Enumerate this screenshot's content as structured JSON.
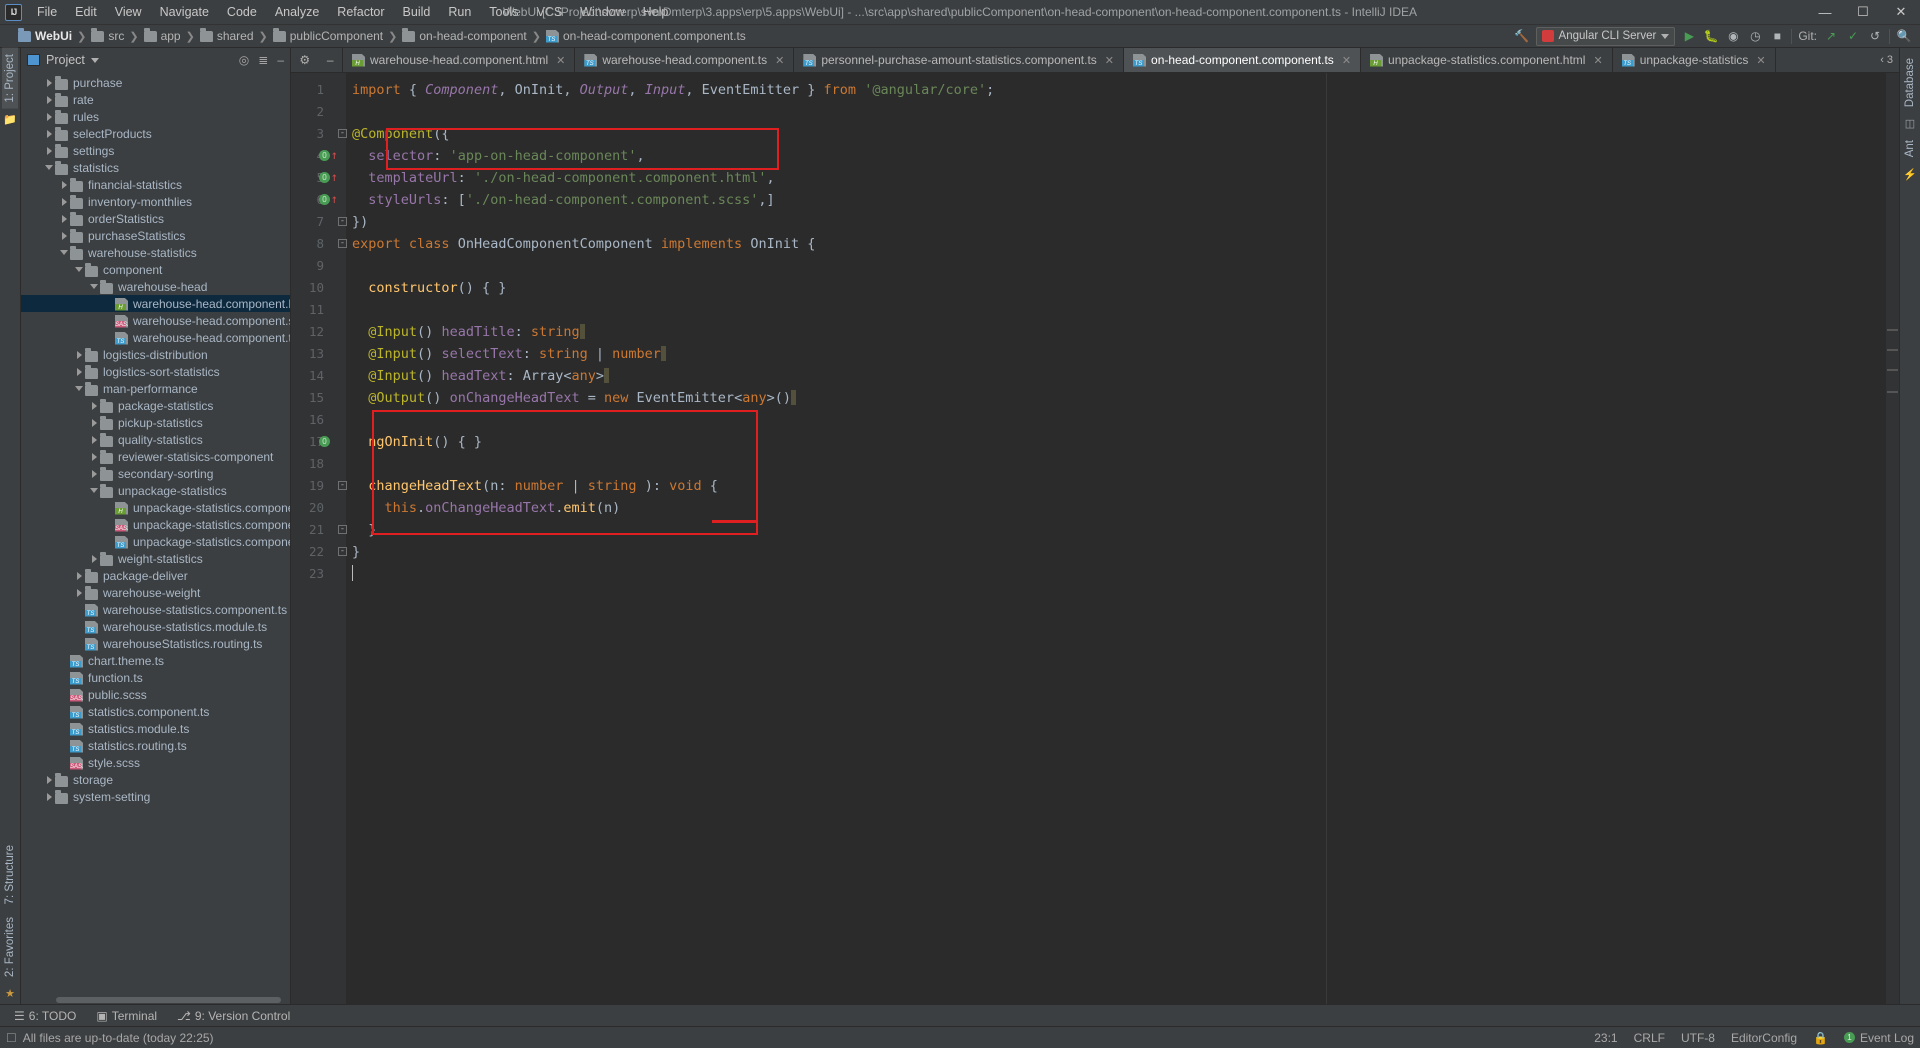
{
  "window": {
    "title": "WebUi [C:\\Project\\svnerp\\svn\\Dmterp\\3.apps\\erp\\5.apps\\WebUi] - ...\\src\\app\\shared\\publicComponent\\on-head-component\\on-head-component.component.ts - IntelliJ IDEA",
    "logo": "IJ",
    "minimize": "—",
    "maximize": "☐",
    "close": "✕"
  },
  "menubar": [
    "File",
    "Edit",
    "View",
    "Navigate",
    "Code",
    "Analyze",
    "Refactor",
    "Build",
    "Run",
    "Tools",
    "VCS",
    "Window",
    "Help"
  ],
  "breadcrumb": [
    {
      "label": "WebUi",
      "icon": "folder-icon"
    },
    {
      "label": "src",
      "icon": "folder-icon"
    },
    {
      "label": "app",
      "icon": "folder-icon"
    },
    {
      "label": "shared",
      "icon": "folder-icon"
    },
    {
      "label": "publicComponent",
      "icon": "folder-icon"
    },
    {
      "label": "on-head-component",
      "icon": "folder-icon"
    },
    {
      "label": "on-head-component.component.ts",
      "icon": "typescript-file-icon"
    }
  ],
  "toolbar": {
    "build_icon": "hammer-icon",
    "run_config": "Angular CLI Server",
    "run_icon": "run-icon",
    "debug_icon": "debug-icon",
    "stop_icon": "stop-icon",
    "coverage_icon": "coverage-icon",
    "profile_icon": "profiler-icon",
    "git_label": "Git:",
    "git_update_icon": "update-project-icon",
    "git_commit_icon": "commit-icon",
    "git_history_icon": "history-icon",
    "search_icon": "search-icon"
  },
  "project_panel": {
    "title": "Project",
    "locate_icon": "locate-file-icon",
    "collapse_icon": "collapse-all-icon",
    "hide_icon": "hide-icon",
    "tree": [
      {
        "label": "purchase",
        "type": "folder",
        "indent": 1,
        "state": "collapsed"
      },
      {
        "label": "rate",
        "type": "folder",
        "indent": 1,
        "state": "collapsed"
      },
      {
        "label": "rules",
        "type": "folder",
        "indent": 1,
        "state": "collapsed"
      },
      {
        "label": "selectProducts",
        "type": "folder",
        "indent": 1,
        "state": "collapsed"
      },
      {
        "label": "settings",
        "type": "folder",
        "indent": 1,
        "state": "collapsed"
      },
      {
        "label": "statistics",
        "type": "folder",
        "indent": 1,
        "state": "expanded"
      },
      {
        "label": "financial-statistics",
        "type": "folder",
        "indent": 2,
        "state": "collapsed"
      },
      {
        "label": "inventory-monthlies",
        "type": "folder",
        "indent": 2,
        "state": "collapsed"
      },
      {
        "label": "orderStatistics",
        "type": "folder",
        "indent": 2,
        "state": "collapsed"
      },
      {
        "label": "purchaseStatistics",
        "type": "folder",
        "indent": 2,
        "state": "collapsed"
      },
      {
        "label": "warehouse-statistics",
        "type": "folder",
        "indent": 2,
        "state": "expanded"
      },
      {
        "label": "component",
        "type": "folder",
        "indent": 3,
        "state": "expanded"
      },
      {
        "label": "warehouse-head",
        "type": "folder",
        "indent": 4,
        "state": "expanded"
      },
      {
        "label": "warehouse-head.component.html",
        "type": "html",
        "indent": 5,
        "state": "none",
        "selected": true
      },
      {
        "label": "warehouse-head.component.scss",
        "type": "scss",
        "indent": 5,
        "state": "none"
      },
      {
        "label": "warehouse-head.component.ts",
        "type": "ts",
        "indent": 5,
        "state": "none"
      },
      {
        "label": "logistics-distribution",
        "type": "folder",
        "indent": 3,
        "state": "collapsed"
      },
      {
        "label": "logistics-sort-statistics",
        "type": "folder",
        "indent": 3,
        "state": "collapsed"
      },
      {
        "label": "man-performance",
        "type": "folder",
        "indent": 3,
        "state": "expanded"
      },
      {
        "label": "package-statistics",
        "type": "folder",
        "indent": 4,
        "state": "collapsed"
      },
      {
        "label": "pickup-statistics",
        "type": "folder",
        "indent": 4,
        "state": "collapsed"
      },
      {
        "label": "quality-statistics",
        "type": "folder",
        "indent": 4,
        "state": "collapsed"
      },
      {
        "label": "reviewer-statisics-component",
        "type": "folder",
        "indent": 4,
        "state": "collapsed"
      },
      {
        "label": "secondary-sorting",
        "type": "folder",
        "indent": 4,
        "state": "collapsed"
      },
      {
        "label": "unpackage-statistics",
        "type": "folder",
        "indent": 4,
        "state": "expanded"
      },
      {
        "label": "unpackage-statistics.component.html",
        "type": "html",
        "indent": 5,
        "state": "none"
      },
      {
        "label": "unpackage-statistics.component.scss",
        "type": "scss",
        "indent": 5,
        "state": "none"
      },
      {
        "label": "unpackage-statistics.component.ts",
        "type": "ts",
        "indent": 5,
        "state": "none"
      },
      {
        "label": "weight-statistics",
        "type": "folder",
        "indent": 4,
        "state": "collapsed"
      },
      {
        "label": "package-deliver",
        "type": "folder",
        "indent": 3,
        "state": "collapsed"
      },
      {
        "label": "warehouse-weight",
        "type": "folder",
        "indent": 3,
        "state": "collapsed"
      },
      {
        "label": "warehouse-statistics.component.ts",
        "type": "ts",
        "indent": 3,
        "state": "none"
      },
      {
        "label": "warehouse-statistics.module.ts",
        "type": "ts",
        "indent": 3,
        "state": "none"
      },
      {
        "label": "warehouseStatistics.routing.ts",
        "type": "ts",
        "indent": 3,
        "state": "none"
      },
      {
        "label": "chart.theme.ts",
        "type": "ts",
        "indent": 2,
        "state": "none"
      },
      {
        "label": "function.ts",
        "type": "ts",
        "indent": 2,
        "state": "none"
      },
      {
        "label": "public.scss",
        "type": "scss",
        "indent": 2,
        "state": "none"
      },
      {
        "label": "statistics.component.ts",
        "type": "ts",
        "indent": 2,
        "state": "none"
      },
      {
        "label": "statistics.module.ts",
        "type": "ts",
        "indent": 2,
        "state": "none"
      },
      {
        "label": "statistics.routing.ts",
        "type": "ts",
        "indent": 2,
        "state": "none"
      },
      {
        "label": "style.scss",
        "type": "scss",
        "indent": 2,
        "state": "none"
      },
      {
        "label": "storage",
        "type": "folder",
        "indent": 1,
        "state": "collapsed"
      },
      {
        "label": "system-setting",
        "type": "folder",
        "indent": 1,
        "state": "collapsed"
      }
    ]
  },
  "left_strip": {
    "project_tab": "1: Project",
    "structure_tab": "7: Structure",
    "favorites_tab": "2: Favorites"
  },
  "right_strip": {
    "database_tab": "Database",
    "ant_tab": "Ant"
  },
  "editor_tabs": [
    {
      "label": "warehouse-head.component.html",
      "icon": "html-file-icon",
      "active": false
    },
    {
      "label": "warehouse-head.component.ts",
      "icon": "typescript-file-icon",
      "active": false
    },
    {
      "label": "personnel-purchase-amount-statistics.component.ts",
      "icon": "typescript-file-icon",
      "active": false
    },
    {
      "label": "on-head-component.component.ts",
      "icon": "typescript-file-icon",
      "active": true
    },
    {
      "label": "unpackage-statistics.component.html",
      "icon": "html-file-icon",
      "active": false
    },
    {
      "label": "unpackage-statistics",
      "icon": "typescript-file-icon",
      "active": false
    }
  ],
  "editor_tabs_overflow": "3",
  "code": {
    "line_numbers": [
      "1",
      "2",
      "3",
      "4",
      "5",
      "6",
      "7",
      "8",
      "9",
      "10",
      "11",
      "12",
      "13",
      "14",
      "15",
      "16",
      "17",
      "18",
      "19",
      "20",
      "21",
      "22",
      "23"
    ],
    "lines": [
      "import { Component, OnInit, Output, Input, EventEmitter } from '@angular/core';",
      "",
      "@Component({",
      "  selector: 'app-on-head-component',",
      "  templateUrl: './on-head-component.component.html',",
      "  styleUrls: ['./on-head-component.component.scss',]",
      "})",
      "export class OnHeadComponentComponent implements OnInit {",
      "",
      "  constructor() { }",
      "",
      "  @Input() headTitle: string",
      "  @Input() selectText: string | number",
      "  @Input() headText: Array<any>",
      "  @Output() onChangeHeadText = new EventEmitter<any>()",
      "",
      "  ngOnInit() { }",
      "",
      "  changeHeadText(n: number | string ): void {",
      "    this.onChangeHeadText.emit(n)",
      "  }",
      "}",
      ""
    ],
    "gutter_markers": [
      {
        "line": 4,
        "badge": "0",
        "arrow": "up"
      },
      {
        "line": 5,
        "badge": "0",
        "arrow": "up"
      },
      {
        "line": 6,
        "badge": "0",
        "arrow": "up"
      },
      {
        "line": 17,
        "badge": "0",
        "arrow": "none"
      }
    ],
    "annotations": [
      {
        "name": "selector-highlight-box",
        "label": "red rectangle around selector line"
      },
      {
        "name": "methods-highlight-box",
        "label": "red rectangle around ngOnInit and changeHeadText"
      }
    ]
  },
  "bottom_tabs": [
    {
      "label": "6: TODO",
      "icon": "todo-icon"
    },
    {
      "label": "Terminal",
      "icon": "terminal-icon"
    },
    {
      "label": "9: Version Control",
      "icon": "version-control-icon"
    }
  ],
  "statusbar": {
    "message": "All files are up-to-date (today 22:25)",
    "message_icon": "vcs-uptodate-icon",
    "caret": "23:1",
    "line_separator": "CRLF",
    "encoding": "UTF-8",
    "editor_config": "EditorConfig",
    "event_log": "Event Log",
    "event_badge": "1",
    "lock_icon": "read-only-icon"
  },
  "colors": {
    "accent": "#4e94ce",
    "highlight_box": "#e02020",
    "selection": "#0d293e",
    "keyword": "#cc7832",
    "string": "#6a8759",
    "annotation": "#bbb529",
    "function": "#ffc66d",
    "purple": "#9876aa"
  }
}
